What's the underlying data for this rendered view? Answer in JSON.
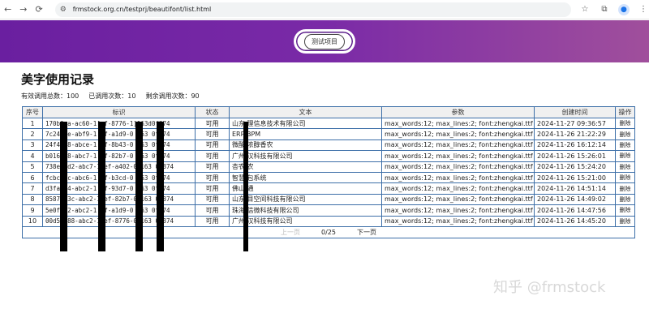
{
  "browser": {
    "url": "frmstock.org.cn/testprj/beautifont/list.html",
    "back": "←",
    "forward": "→",
    "reload": "⟳"
  },
  "banner": {
    "test_button_label": "测试项目"
  },
  "page": {
    "title": "美字使用记录",
    "stats": {
      "total": "有效调用总数：100",
      "used": "已调用次数：10",
      "remaining": "剩余调用次数：90"
    }
  },
  "table": {
    "headers": [
      "序号",
      "标识",
      "状态",
      "文本",
      "参数",
      "创建时间",
      "操作"
    ],
    "rows": [
      {
        "no": "1",
        "id": "170b6ea-ac60-1[ef-8776-1]163d0f374",
        "status": "可用",
        "text": "山东 理信息技术有限公司",
        "params": "max_words:12; max_lines:2; font:zhengkai.ttf",
        "time": "2024-11-27 09:36:57",
        "action": "删除"
      },
      {
        "no": "2",
        "id": "7c24 ee-abf9-1 ef-a1d9-0 163 0f374",
        "status": "可用",
        "text": "ERP BPM",
        "params": "max_words:12; max_lines:2; font:zhengkai.ttf",
        "time": "2024-11-26 21:22:29",
        "action": "删除"
      },
      {
        "no": "3",
        "id": "24f4 e8-abce-1 ef-8b43-0 163 0f374",
        "status": "可用",
        "text": "微酸 浓醇香农",
        "params": "max_words:12; max_lines:2; font:zhengkai.ttf",
        "time": "2024-11-26 16:12:14",
        "action": "删除"
      },
      {
        "no": "4",
        "id": "b016 e8-abc7-1 ef-82b7-0 163 0f374",
        "status": "可用",
        "text": "广州 汉科技有限公司",
        "params": "max_words:12; max_lines:2; font:zhengkai.ttf",
        "time": "2024-11-26 15:26:01",
        "action": "删除"
      },
      {
        "no": "5",
        "id": "738e 9d2-abc7-1 ef-a402-0 163 0f374",
        "status": "可用",
        "text": "杏农 农",
        "params": "max_words:12; max_lines:2; font:zhengkai.ttf",
        "time": "2024-11-26 15:24:20",
        "action": "删除"
      },
      {
        "no": "6",
        "id": "fcbc dc-abc6-1 ef-b3cd-0 163 0f374",
        "status": "可用",
        "text": "智慧 包系统",
        "params": "max_words:12; max_lines:2; font:zhengkai.ttf",
        "time": "2024-11-26 15:21:00",
        "action": "删除"
      },
      {
        "no": "7",
        "id": "d3fa 74-abc2-1 ef-93d7-0 163 0f374",
        "status": "可用",
        "text": "佛山 通",
        "params": "max_words:12; max_lines:2; font:zhengkai.ttf",
        "time": "2024-11-26 14:51:14",
        "action": "删除"
      },
      {
        "no": "8",
        "id": "8587 b3c-abc2-1 ef-82b7-0 163 0f374",
        "status": "可用",
        "text": "山东 目空间科技有限公司",
        "params": "max_words:12; max_lines:2; font:zhengkai.ttf",
        "time": "2024-11-26 14:49:02",
        "action": "删除"
      },
      {
        "no": "9",
        "id": "5e0f f2-abc2-1 ef-a1d9-0 163 0f374",
        "status": "可用",
        "text": "珠海 信微科技有限公司",
        "params": "max_words:12; max_lines:2; font:zhengkai.ttf",
        "time": "2024-11-26 14:47:56",
        "action": "删除"
      },
      {
        "no": "10",
        "id": "00d5 a88-abc2-1 ef-8776-0 163 0f374",
        "status": "可用",
        "text": "广州 汉科技有限公司",
        "params": "max_words:12; max_lines:2; font:zhengkai.ttf",
        "time": "2024-11-26 14:45:20",
        "action": "删除"
      }
    ]
  },
  "pager": {
    "prev": "上一页",
    "page": "0/25",
    "next": "下一页"
  },
  "watermark": "知乎 @frmstock"
}
